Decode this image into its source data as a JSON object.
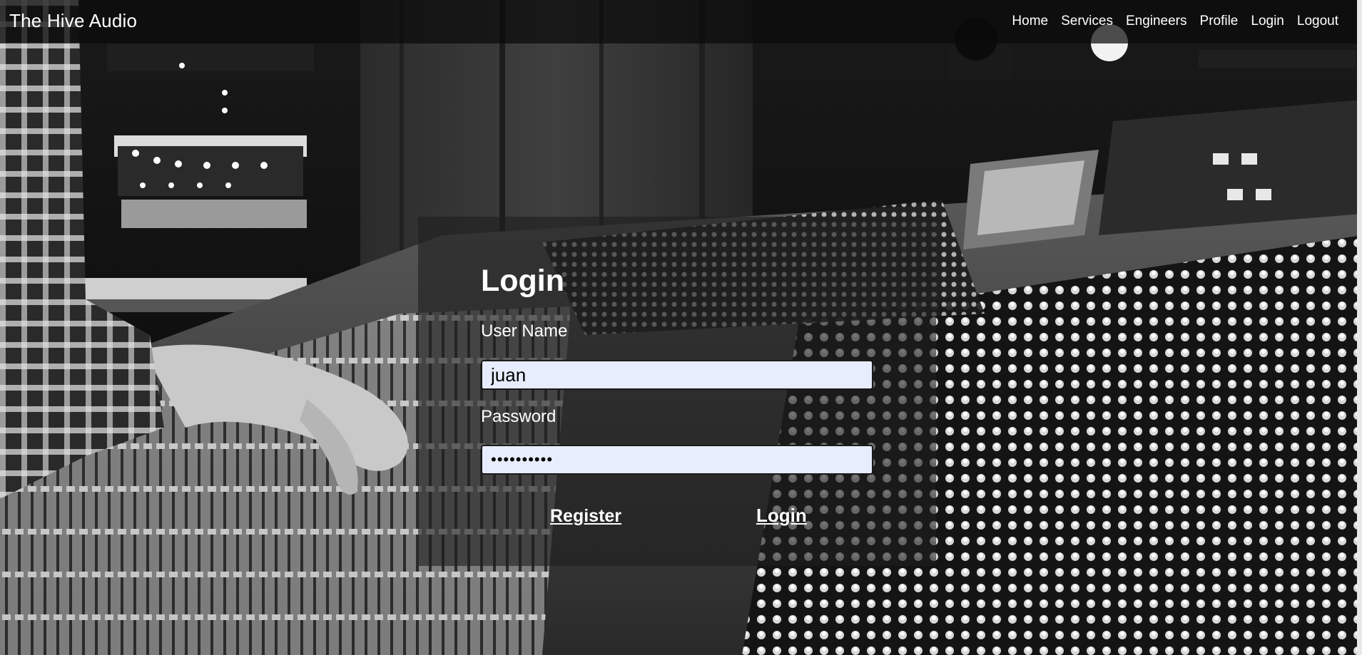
{
  "navbar": {
    "brand": "The Hive Audio",
    "links": [
      {
        "label": "Home"
      },
      {
        "label": "Services"
      },
      {
        "label": "Engineers"
      },
      {
        "label": "Profile"
      },
      {
        "label": "Login"
      },
      {
        "label": "Logout"
      }
    ]
  },
  "login_form": {
    "title": "Login",
    "username_label": "User Name",
    "username_value": "juan",
    "password_label": "Password",
    "password_value": "••••••••••",
    "register_label": "Register",
    "submit_label": "Login"
  },
  "background": {
    "description_icon": "mixing-console-photo"
  },
  "colors": {
    "input_background": "#e8edfd",
    "panel_background": "#1e1e1e",
    "text": "#ffffff"
  }
}
